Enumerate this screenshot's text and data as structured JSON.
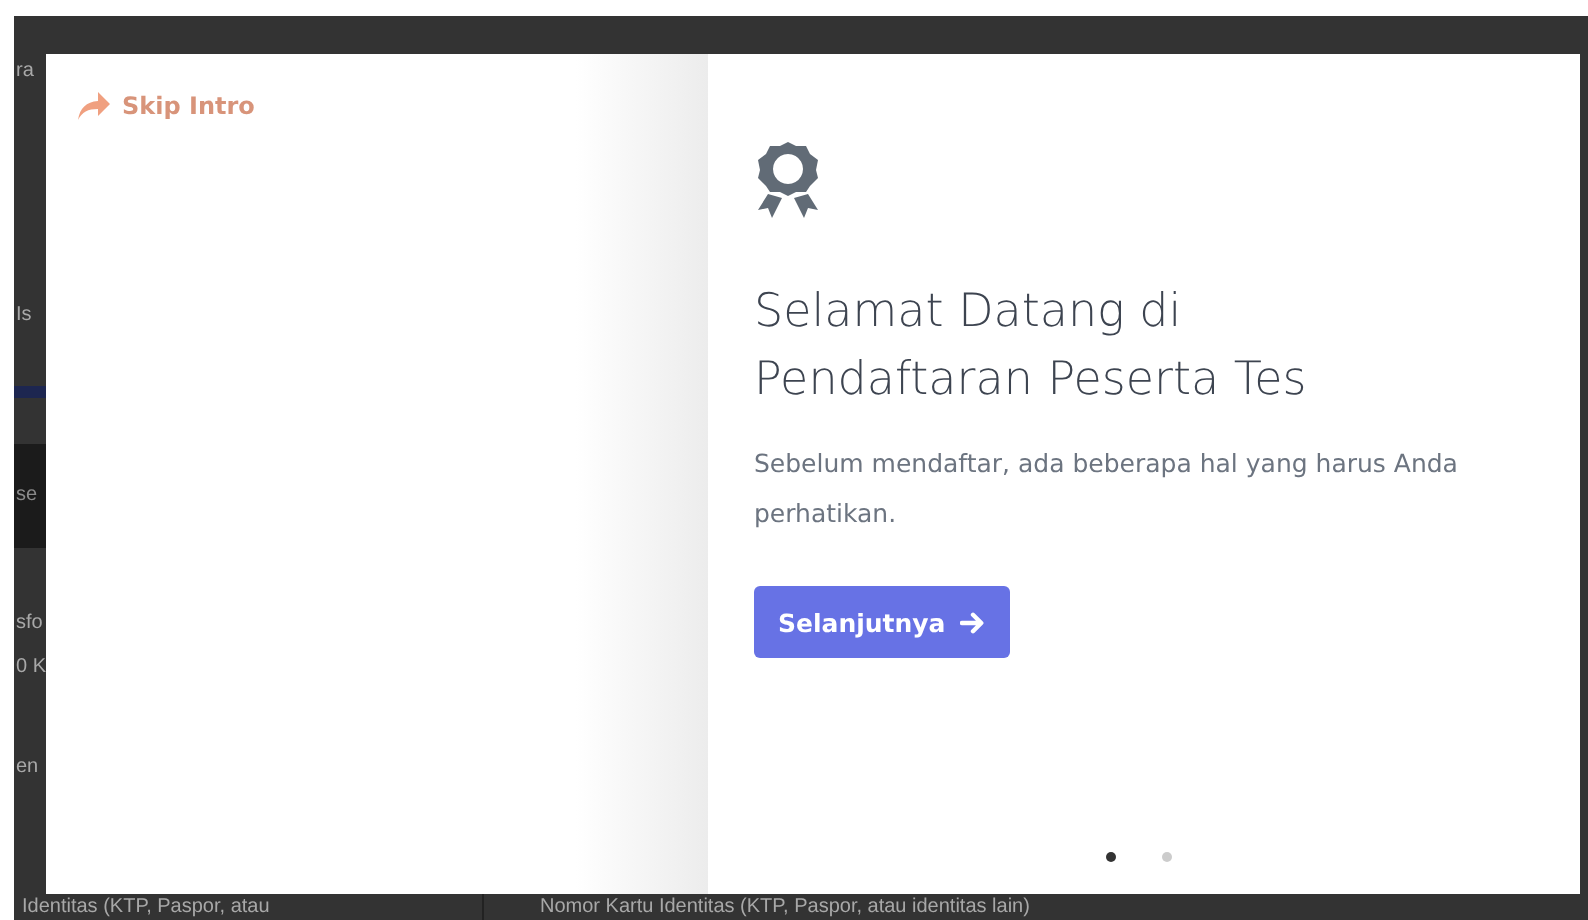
{
  "backdrop": {
    "fragments": [
      {
        "kind": "plain",
        "text": "ra"
      },
      {
        "kind": "plain",
        "text": "Is"
      },
      {
        "kind": "band",
        "text": "se"
      },
      {
        "kind": "plain",
        "text": "sfo"
      },
      {
        "kind": "plain",
        "text": "0 K"
      },
      {
        "kind": "plain",
        "text": "en"
      }
    ],
    "bottom_labels": [
      "Identitas (KTP, Paspor, atau",
      "Nomor Kartu Identitas (KTP, Paspor, atau identitas lain)"
    ]
  },
  "modal": {
    "skip_link": "Skip Intro",
    "title_lines": [
      "Selamat Datang di",
      "Pendaftaran Peserta Tes"
    ],
    "description": "Sebelum mendaftar, ada beberapa hal yang harus Anda perhatikan.",
    "next_button": "Selanjutnya",
    "pager_dots": [
      {
        "selected": true
      },
      {
        "selected": false
      }
    ]
  }
}
